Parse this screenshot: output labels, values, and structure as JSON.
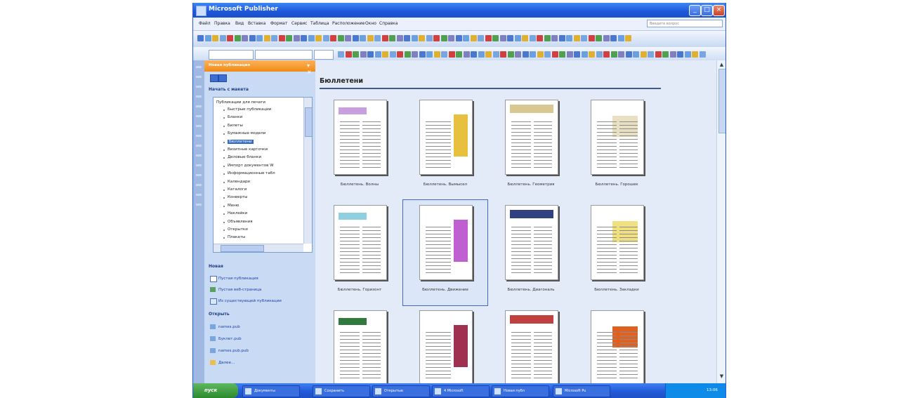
{
  "window": {
    "title": "Microsoft Publisher",
    "controls": [
      "_",
      "□",
      "×"
    ]
  },
  "menu": {
    "items": [
      "Файл",
      "Правка",
      "Вид",
      "Вставка",
      "Формат",
      "Сервис",
      "Таблица",
      "Расположение",
      "Окно",
      "Справка"
    ],
    "help_placeholder": "Введите вопрос"
  },
  "task_pane": {
    "title": "Новая публикация",
    "section_start": "Начать с макета",
    "tree_root": "Публикации для печати",
    "tree_items": [
      "Быстрые публикации",
      "Бланки",
      "Билеты",
      "Бумажные модели",
      "Бюллетени",
      "Визитные карточки",
      "Деловые бланки",
      "Импорт документов W",
      "Информационные табл",
      "Календари",
      "Каталоги",
      "Конверты",
      "Меню",
      "Наклейки",
      "Объявления",
      "Открытки",
      "Плакаты"
    ],
    "selected_index": 4,
    "section_new": "Новая",
    "new_links": [
      "Пустая публикация",
      "Пустая веб-страница",
      "Из существующей публикации"
    ],
    "section_open": "Открыть",
    "open_links": [
      "names.pub",
      "Буклет.pub",
      "names.pub.pub",
      "Далее..."
    ]
  },
  "content": {
    "title": "Бюллетени",
    "templates": [
      {
        "label": "Бюллетень. Волны",
        "accent": "#c8a0e0"
      },
      {
        "label": "Бюллетень. Вымысел",
        "accent": "#e8c040"
      },
      {
        "label": "Бюллетень. Геометрия",
        "accent": "#d8c890"
      },
      {
        "label": "Бюллетень. Горошек",
        "accent": "#e8e0c0"
      },
      {
        "label": "Бюллетень. Горизонт",
        "accent": "#8fd0e0"
      },
      {
        "label": "Бюллетень. Движение",
        "accent": "#c060d0",
        "selected": true
      },
      {
        "label": "Бюллетень. Диагональ",
        "accent": "#304080"
      },
      {
        "label": "Бюллетень. Закладки",
        "accent": "#f0e080"
      },
      {
        "label": "",
        "accent": "#2f7a3c"
      },
      {
        "label": "",
        "accent": "#a03050"
      },
      {
        "label": "",
        "accent": "#c04040"
      },
      {
        "label": "",
        "accent": "#e06020"
      }
    ]
  },
  "taskbar": {
    "start_label": "пуск",
    "tasks": [
      "Документы",
      "Сохранить",
      "Открытые",
      "4 Microsoft",
      "Новая публ",
      "Microsoft Pu"
    ],
    "clock": "13:06"
  }
}
